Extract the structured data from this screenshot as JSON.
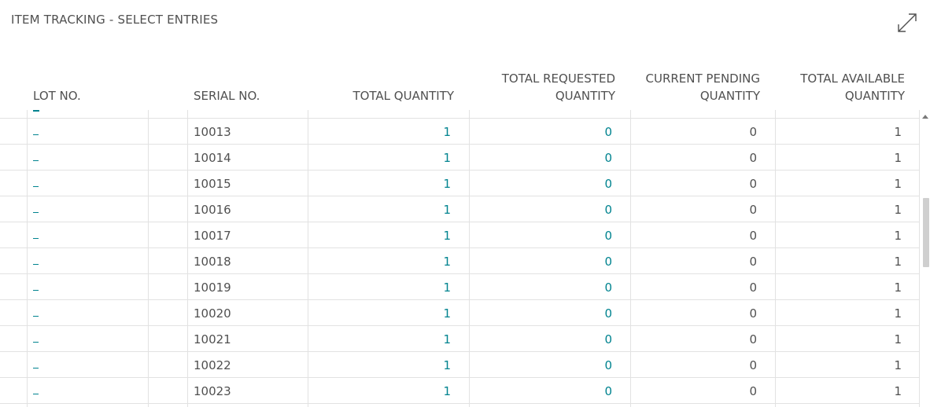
{
  "window": {
    "title": "ITEM TRACKING - SELECT ENTRIES",
    "expand_icon": "expand-icon"
  },
  "columns": {
    "lot_no": "LOT NO.",
    "serial_no": "SERIAL NO.",
    "total_quantity": "TOTAL QUANTITY",
    "total_requested_1": "TOTAL REQUESTED",
    "total_requested_2": "QUANTITY",
    "current_pending_1": "CURRENT PENDING",
    "current_pending_2": "QUANTITY",
    "total_available_1": "TOTAL AVAILABLE",
    "total_available_2": "QUANTITY"
  },
  "rows": [
    {
      "lot": "_",
      "serial": "10013",
      "total": "1",
      "requested": "0",
      "pending": "0",
      "available": "1"
    },
    {
      "lot": "_",
      "serial": "10014",
      "total": "1",
      "requested": "0",
      "pending": "0",
      "available": "1"
    },
    {
      "lot": "_",
      "serial": "10015",
      "total": "1",
      "requested": "0",
      "pending": "0",
      "available": "1"
    },
    {
      "lot": "_",
      "serial": "10016",
      "total": "1",
      "requested": "0",
      "pending": "0",
      "available": "1"
    },
    {
      "lot": "_",
      "serial": "10017",
      "total": "1",
      "requested": "0",
      "pending": "0",
      "available": "1"
    },
    {
      "lot": "_",
      "serial": "10018",
      "total": "1",
      "requested": "0",
      "pending": "0",
      "available": "1"
    },
    {
      "lot": "_",
      "serial": "10019",
      "total": "1",
      "requested": "0",
      "pending": "0",
      "available": "1"
    },
    {
      "lot": "_",
      "serial": "10020",
      "total": "1",
      "requested": "0",
      "pending": "0",
      "available": "1"
    },
    {
      "lot": "_",
      "serial": "10021",
      "total": "1",
      "requested": "0",
      "pending": "0",
      "available": "1"
    },
    {
      "lot": "_",
      "serial": "10022",
      "total": "1",
      "requested": "0",
      "pending": "0",
      "available": "1"
    },
    {
      "lot": "_",
      "serial": "10023",
      "total": "1",
      "requested": "0",
      "pending": "0",
      "available": "1"
    }
  ],
  "colors": {
    "link": "#00838f",
    "text": "#505050",
    "grid": "#e2e2e2"
  }
}
